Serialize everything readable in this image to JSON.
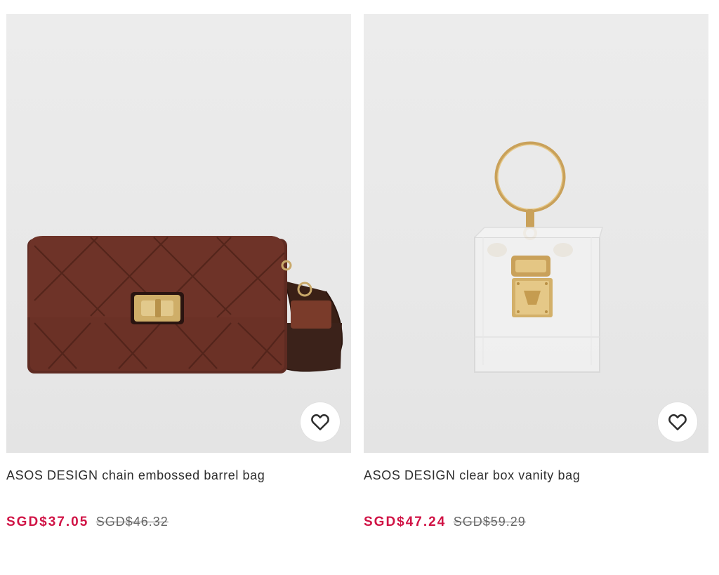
{
  "products": [
    {
      "title": "ASOS DESIGN chain embossed barrel bag",
      "price_current": "SGD$37.05",
      "price_original": "SGD$46.32"
    },
    {
      "title": "ASOS DESIGN clear box vanity bag",
      "price_current": "SGD$47.24",
      "price_original": "SGD$59.29"
    }
  ],
  "icons": {
    "wishlist": "heart-outline-icon"
  },
  "colors": {
    "price_current": "#d01345",
    "price_original": "#666666",
    "title": "#2d2d2d",
    "image_background": "#eaeaea"
  }
}
